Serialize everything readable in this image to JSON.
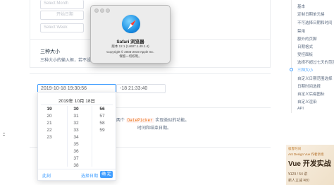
{
  "demo": {
    "month_placeholder": "Select Month",
    "start_date_placeholder": "开始日期",
    "week_placeholder": "Select Week"
  },
  "section": {
    "title": "三种大小",
    "description": "三种大小的输入框，若不设置，则为 default"
  },
  "inputs": {
    "datetime1_value": "2019-10-18 19:30:56",
    "datetime2_value": "-18 21:33:40"
  },
  "picker": {
    "title": "2019年 10月 18日",
    "hours": [
      "19",
      "20",
      "21",
      "22",
      "23"
    ],
    "minutes": [
      "30",
      "31",
      "32",
      "33",
      "34",
      "35",
      "36",
      "37",
      "38"
    ],
    "seconds": [
      "56",
      "57",
      "58",
      "59"
    ],
    "now_label": "此刻",
    "select_date_label": "选择日期",
    "confirm_label": "确 定"
  },
  "doc": {
    "line1_prefix": "两个",
    "code": "DatePicker",
    "line1_suffix": "实现类似的功能。",
    "line2": "时间和结束日期。"
  },
  "about_dialog": {
    "app_name": "Safari 浏览器",
    "version": "版本 12.1 (14607.1.40.1.4)",
    "copyright": "Copyright © 2003-2019 Apple Inc.",
    "rights": "保留一切权利。",
    "icon": "safari-compass-icon"
  },
  "toc": {
    "items": [
      "基本",
      "定制日期单元格",
      "不可选择日期和时间",
      "禁用",
      "额外的页脚",
      "日期格式",
      "受控面板",
      "选择不超过七天的范围",
      "三种大小",
      "自定义日期范围选择",
      "日期时间选择",
      "自定义后缀图标",
      "自定义渲染",
      "API"
    ],
    "active_index": 8
  },
  "ad": {
    "brand": "极客时间",
    "tag": "Ant Design Vue 作者亲授",
    "title": "Vue 开发实战",
    "price": "¥129 / 54 讲",
    "join": "新人立减 ¥80"
  }
}
